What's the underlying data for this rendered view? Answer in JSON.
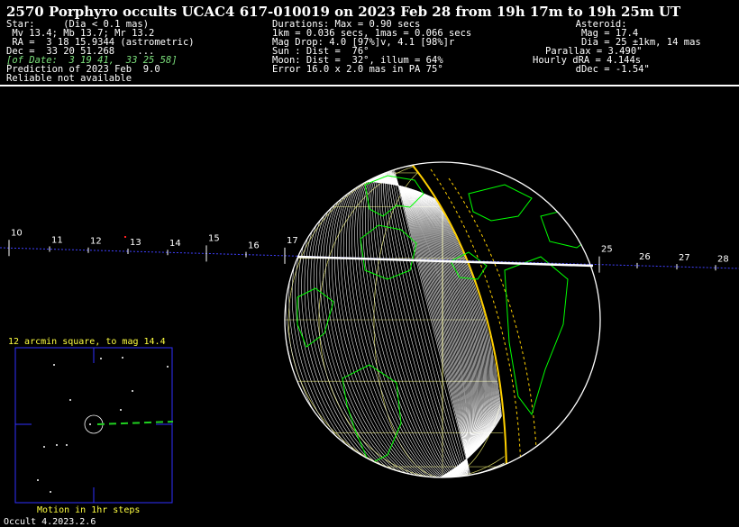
{
  "header": {
    "title": "2570 Porphyro occults UCAC4 617-010019 on 2023 Feb 28 from 19h 17m to 19h 25m UT",
    "star": {
      "line1": "Star:     (Dia < 0.1 mas)",
      "line2": " Mv 13.4; Mb 13.7; Mr 13.2",
      " line3": "",
      "line3": " RA =  3 18 15.9344 (astrometric)",
      "line4": "Dec =  33 20 51.268    ...",
      "line5": "[of Date:  3 19 41,  33 25 58]",
      "line6": "Prediction of 2023 Feb  9.0",
      "line7": "Reliable not available"
    },
    "event": {
      "line1": "Durations: Max = 0.90 secs",
      "line2": "1km = 0.036 secs, 1mas = 0.066 secs",
      "line3": "Mag Drop: 4.0 [97%]v, 4.1 [98%]r",
      "line4": "Sun : Dist =  76°",
      "line5": "Moon: Dist =  32°, illum = 64%",
      "line6": "Error 16.0 x 2.0 mas in PA 75°"
    },
    "asteroid": {
      "line1": "  Asteroid:",
      "line2": "   Mag = 17.4",
      "line3": "   Dia = 25 ±1km, 14 mas",
      "line4": "Parallax = 3.490\"",
      "line5": "Hourly dRA = 4.144s",
      "line6": "  dDec = -1.54\""
    }
  },
  "path": {
    "ticks": [
      "10",
      "11",
      "12",
      "13",
      "14",
      "15",
      "16",
      "17",
      "25",
      "26",
      "27",
      "28"
    ]
  },
  "star_chart": {
    "caption": "12 arcmin square, to mag 14.4",
    "footer": "Motion in 1hr steps"
  },
  "footer": {
    "version": "Occult 4.2023.2.6"
  },
  "colors": {
    "limb": "#ffffff",
    "coast": "#00ff00",
    "shadow": "#ffd000",
    "grid": "#c8c860",
    "path": "#4040ff"
  }
}
